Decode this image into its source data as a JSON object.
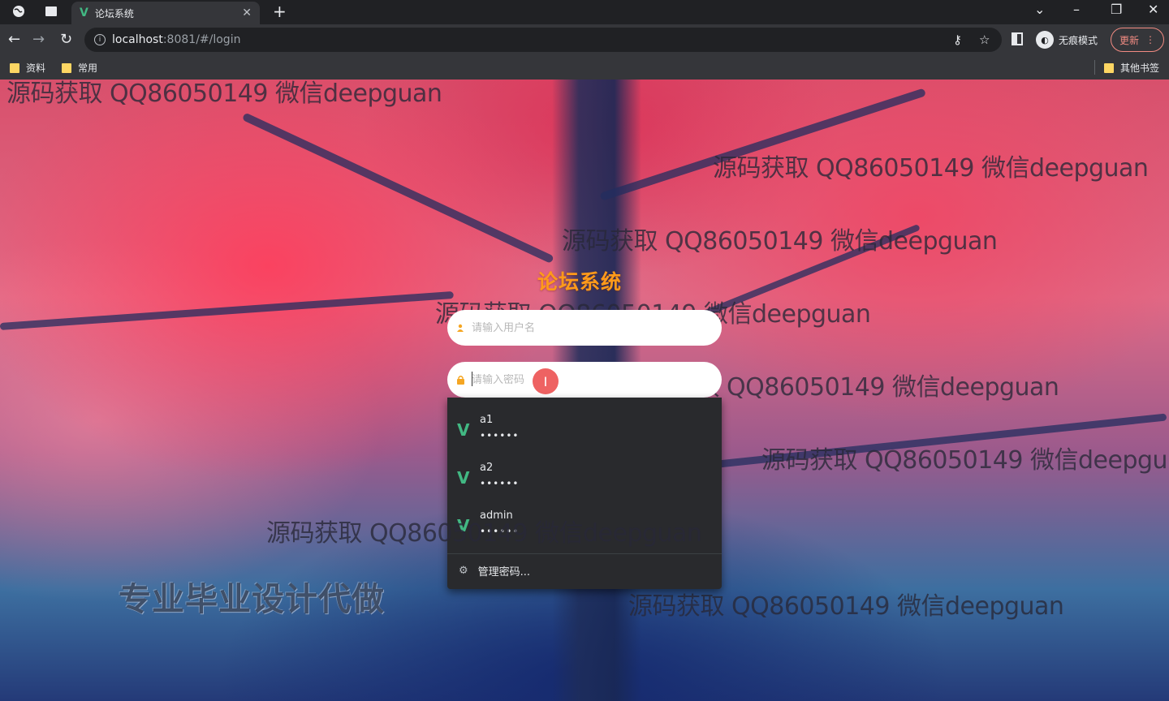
{
  "browser": {
    "tab_title": "论坛系统",
    "address_host": "localhost",
    "address_rest": ":8081/#/login",
    "incognito_label": "无痕模式",
    "update_label": "更新",
    "bookmarks": [
      "资料",
      "常用"
    ],
    "other_bookmarks": "其他书签"
  },
  "page": {
    "title": "论坛系统",
    "username_placeholder": "请输入用户名",
    "password_placeholder": "请输入密码",
    "promo_text": "专业毕业设计代做",
    "watermark_text": "源码获取 QQ86050149 微信deepguan",
    "watermark_truncated": "源码获取 QQ86050149 微信deepgu"
  },
  "autocomplete": {
    "items": [
      {
        "username": "a1",
        "password": "••••••"
      },
      {
        "username": "a2",
        "password": "••••••"
      },
      {
        "username": "admin",
        "password": "••••••"
      }
    ],
    "manage_label": "管理密码..."
  },
  "colors": {
    "accent_title": "#ff9a1a",
    "vue_green": "#42b883",
    "update_red": "#f28b82"
  }
}
